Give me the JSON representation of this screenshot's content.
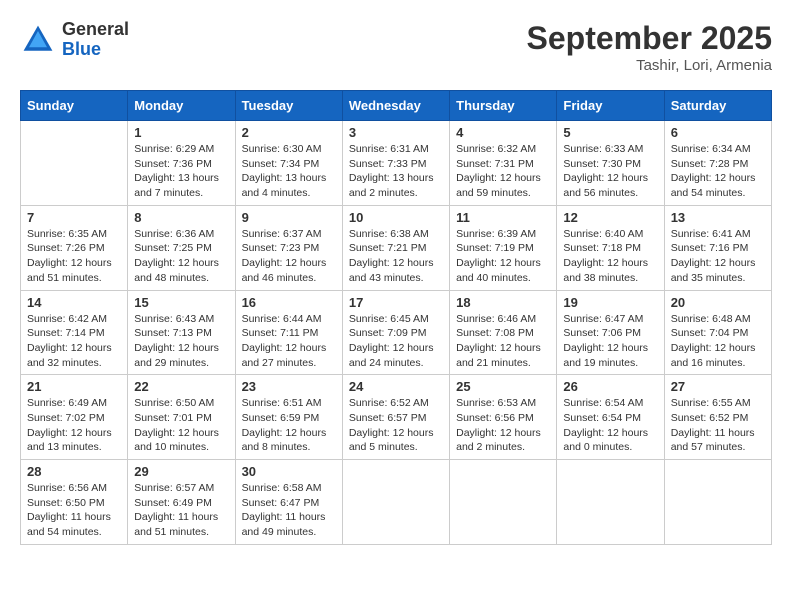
{
  "header": {
    "logo_general": "General",
    "logo_blue": "Blue",
    "month_title": "September 2025",
    "location": "Tashir, Lori, Armenia"
  },
  "days_of_week": [
    "Sunday",
    "Monday",
    "Tuesday",
    "Wednesday",
    "Thursday",
    "Friday",
    "Saturday"
  ],
  "weeks": [
    [
      {
        "day": "",
        "lines": []
      },
      {
        "day": "1",
        "lines": [
          "Sunrise: 6:29 AM",
          "Sunset: 7:36 PM",
          "Daylight: 13 hours",
          "and 7 minutes."
        ]
      },
      {
        "day": "2",
        "lines": [
          "Sunrise: 6:30 AM",
          "Sunset: 7:34 PM",
          "Daylight: 13 hours",
          "and 4 minutes."
        ]
      },
      {
        "day": "3",
        "lines": [
          "Sunrise: 6:31 AM",
          "Sunset: 7:33 PM",
          "Daylight: 13 hours",
          "and 2 minutes."
        ]
      },
      {
        "day": "4",
        "lines": [
          "Sunrise: 6:32 AM",
          "Sunset: 7:31 PM",
          "Daylight: 12 hours",
          "and 59 minutes."
        ]
      },
      {
        "day": "5",
        "lines": [
          "Sunrise: 6:33 AM",
          "Sunset: 7:30 PM",
          "Daylight: 12 hours",
          "and 56 minutes."
        ]
      },
      {
        "day": "6",
        "lines": [
          "Sunrise: 6:34 AM",
          "Sunset: 7:28 PM",
          "Daylight: 12 hours",
          "and 54 minutes."
        ]
      }
    ],
    [
      {
        "day": "7",
        "lines": [
          "Sunrise: 6:35 AM",
          "Sunset: 7:26 PM",
          "Daylight: 12 hours",
          "and 51 minutes."
        ]
      },
      {
        "day": "8",
        "lines": [
          "Sunrise: 6:36 AM",
          "Sunset: 7:25 PM",
          "Daylight: 12 hours",
          "and 48 minutes."
        ]
      },
      {
        "day": "9",
        "lines": [
          "Sunrise: 6:37 AM",
          "Sunset: 7:23 PM",
          "Daylight: 12 hours",
          "and 46 minutes."
        ]
      },
      {
        "day": "10",
        "lines": [
          "Sunrise: 6:38 AM",
          "Sunset: 7:21 PM",
          "Daylight: 12 hours",
          "and 43 minutes."
        ]
      },
      {
        "day": "11",
        "lines": [
          "Sunrise: 6:39 AM",
          "Sunset: 7:19 PM",
          "Daylight: 12 hours",
          "and 40 minutes."
        ]
      },
      {
        "day": "12",
        "lines": [
          "Sunrise: 6:40 AM",
          "Sunset: 7:18 PM",
          "Daylight: 12 hours",
          "and 38 minutes."
        ]
      },
      {
        "day": "13",
        "lines": [
          "Sunrise: 6:41 AM",
          "Sunset: 7:16 PM",
          "Daylight: 12 hours",
          "and 35 minutes."
        ]
      }
    ],
    [
      {
        "day": "14",
        "lines": [
          "Sunrise: 6:42 AM",
          "Sunset: 7:14 PM",
          "Daylight: 12 hours",
          "and 32 minutes."
        ]
      },
      {
        "day": "15",
        "lines": [
          "Sunrise: 6:43 AM",
          "Sunset: 7:13 PM",
          "Daylight: 12 hours",
          "and 29 minutes."
        ]
      },
      {
        "day": "16",
        "lines": [
          "Sunrise: 6:44 AM",
          "Sunset: 7:11 PM",
          "Daylight: 12 hours",
          "and 27 minutes."
        ]
      },
      {
        "day": "17",
        "lines": [
          "Sunrise: 6:45 AM",
          "Sunset: 7:09 PM",
          "Daylight: 12 hours",
          "and 24 minutes."
        ]
      },
      {
        "day": "18",
        "lines": [
          "Sunrise: 6:46 AM",
          "Sunset: 7:08 PM",
          "Daylight: 12 hours",
          "and 21 minutes."
        ]
      },
      {
        "day": "19",
        "lines": [
          "Sunrise: 6:47 AM",
          "Sunset: 7:06 PM",
          "Daylight: 12 hours",
          "and 19 minutes."
        ]
      },
      {
        "day": "20",
        "lines": [
          "Sunrise: 6:48 AM",
          "Sunset: 7:04 PM",
          "Daylight: 12 hours",
          "and 16 minutes."
        ]
      }
    ],
    [
      {
        "day": "21",
        "lines": [
          "Sunrise: 6:49 AM",
          "Sunset: 7:02 PM",
          "Daylight: 12 hours",
          "and 13 minutes."
        ]
      },
      {
        "day": "22",
        "lines": [
          "Sunrise: 6:50 AM",
          "Sunset: 7:01 PM",
          "Daylight: 12 hours",
          "and 10 minutes."
        ]
      },
      {
        "day": "23",
        "lines": [
          "Sunrise: 6:51 AM",
          "Sunset: 6:59 PM",
          "Daylight: 12 hours",
          "and 8 minutes."
        ]
      },
      {
        "day": "24",
        "lines": [
          "Sunrise: 6:52 AM",
          "Sunset: 6:57 PM",
          "Daylight: 12 hours",
          "and 5 minutes."
        ]
      },
      {
        "day": "25",
        "lines": [
          "Sunrise: 6:53 AM",
          "Sunset: 6:56 PM",
          "Daylight: 12 hours",
          "and 2 minutes."
        ]
      },
      {
        "day": "26",
        "lines": [
          "Sunrise: 6:54 AM",
          "Sunset: 6:54 PM",
          "Daylight: 12 hours",
          "and 0 minutes."
        ]
      },
      {
        "day": "27",
        "lines": [
          "Sunrise: 6:55 AM",
          "Sunset: 6:52 PM",
          "Daylight: 11 hours",
          "and 57 minutes."
        ]
      }
    ],
    [
      {
        "day": "28",
        "lines": [
          "Sunrise: 6:56 AM",
          "Sunset: 6:50 PM",
          "Daylight: 11 hours",
          "and 54 minutes."
        ]
      },
      {
        "day": "29",
        "lines": [
          "Sunrise: 6:57 AM",
          "Sunset: 6:49 PM",
          "Daylight: 11 hours",
          "and 51 minutes."
        ]
      },
      {
        "day": "30",
        "lines": [
          "Sunrise: 6:58 AM",
          "Sunset: 6:47 PM",
          "Daylight: 11 hours",
          "and 49 minutes."
        ]
      },
      {
        "day": "",
        "lines": []
      },
      {
        "day": "",
        "lines": []
      },
      {
        "day": "",
        "lines": []
      },
      {
        "day": "",
        "lines": []
      }
    ]
  ]
}
